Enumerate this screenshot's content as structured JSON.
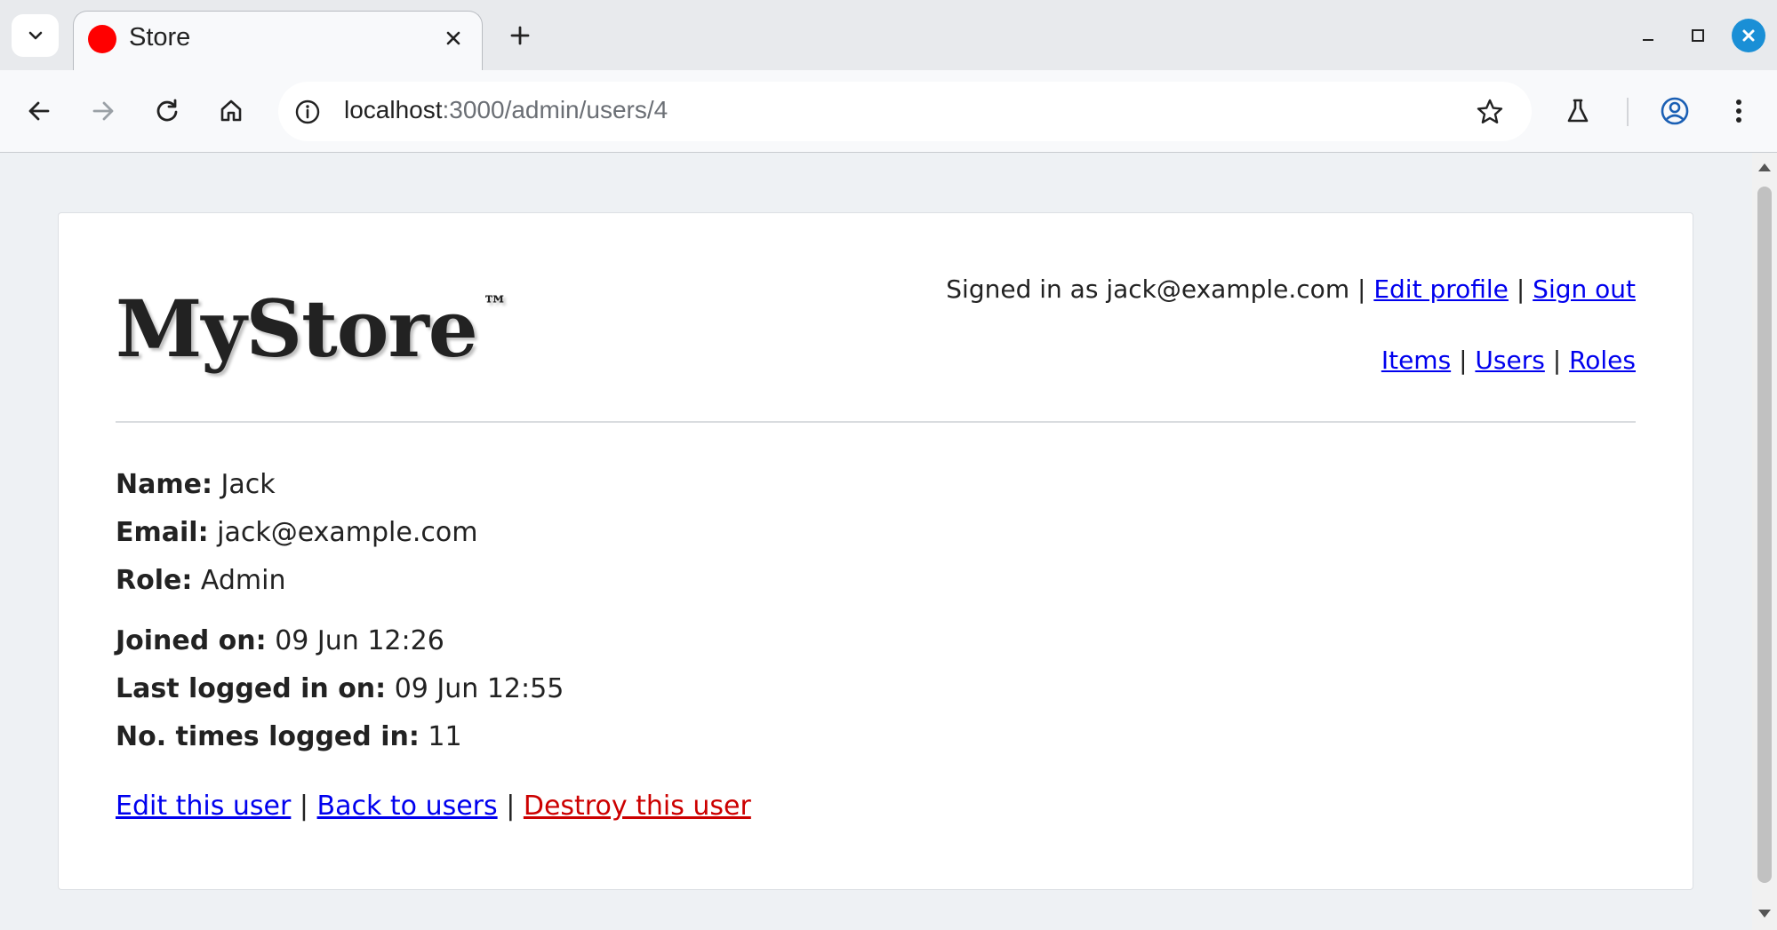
{
  "browser": {
    "tab_title": "Store",
    "url_host": "localhost",
    "url_rest": ":3000/admin/users/4",
    "favicon_color": "#ff0000"
  },
  "header": {
    "logo": "MyStore",
    "logo_mark": "™",
    "signed_in_prefix": "Signed in as jack@example.com",
    "separator": "|",
    "edit_profile": "Edit profile",
    "sign_out": "Sign out",
    "nav": {
      "items": "Items",
      "users": "Users",
      "roles": "Roles"
    }
  },
  "user": {
    "name_label": "Name:",
    "name": "Jack",
    "email_label": "Email:",
    "email": "jack@example.com",
    "role_label": "Role:",
    "role": "Admin",
    "joined_label": "Joined on:",
    "joined": "09 Jun 12:26",
    "last_login_label": "Last logged in on:",
    "last_login": "09 Jun 12:55",
    "times_label": "No. times logged in:",
    "times": "11"
  },
  "actions": {
    "edit": "Edit this user",
    "back": "Back to users",
    "destroy": "Destroy this user",
    "separator": "|"
  },
  "colors": {
    "link": "#0000ee",
    "danger_link": "#cc0000",
    "page_bg": "#eef1f4"
  }
}
